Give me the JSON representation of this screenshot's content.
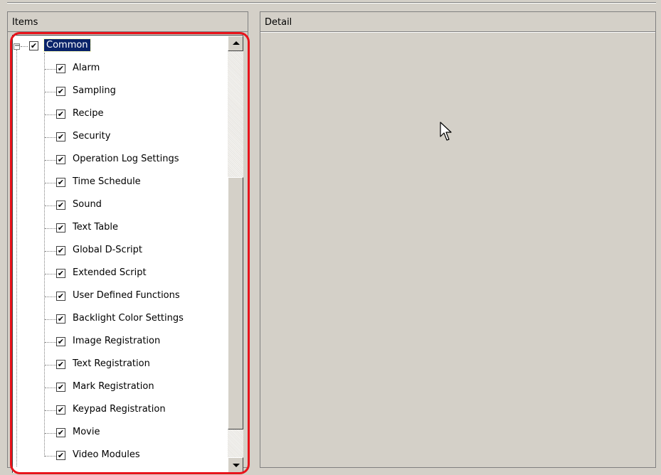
{
  "items_panel": {
    "header": "Items",
    "root": {
      "label": "Common",
      "checked": true,
      "expanded": true,
      "selected": true
    },
    "children": [
      {
        "label": "Alarm",
        "checked": true
      },
      {
        "label": "Sampling",
        "checked": true
      },
      {
        "label": "Recipe",
        "checked": true
      },
      {
        "label": "Security",
        "checked": true
      },
      {
        "label": "Operation Log Settings",
        "checked": true
      },
      {
        "label": "Time Schedule",
        "checked": true
      },
      {
        "label": "Sound",
        "checked": true
      },
      {
        "label": "Text Table",
        "checked": true
      },
      {
        "label": "Global D-Script",
        "checked": true
      },
      {
        "label": "Extended Script",
        "checked": true
      },
      {
        "label": "User Defined Functions",
        "checked": true
      },
      {
        "label": "Backlight Color Settings",
        "checked": true
      },
      {
        "label": "Image Registration",
        "checked": true
      },
      {
        "label": "Text Registration",
        "checked": true
      },
      {
        "label": "Mark Registration",
        "checked": true
      },
      {
        "label": "Keypad Registration",
        "checked": true
      },
      {
        "label": "Movie",
        "checked": true
      },
      {
        "label": "Video Modules",
        "checked": true
      }
    ]
  },
  "detail_panel": {
    "header": "Detail"
  },
  "icons": {
    "expander": "minus",
    "check": "✔",
    "scroll_up": "scroll-up-arrow",
    "scroll_down": "scroll-down-arrow",
    "cursor": "mouse-pointer"
  },
  "colors": {
    "window_bg": "#d4d0c8",
    "tree_bg": "#ffffff",
    "selection_bg": "#0a246a",
    "selection_fg": "#ffffff",
    "highlight_ring": "#e8131b"
  }
}
